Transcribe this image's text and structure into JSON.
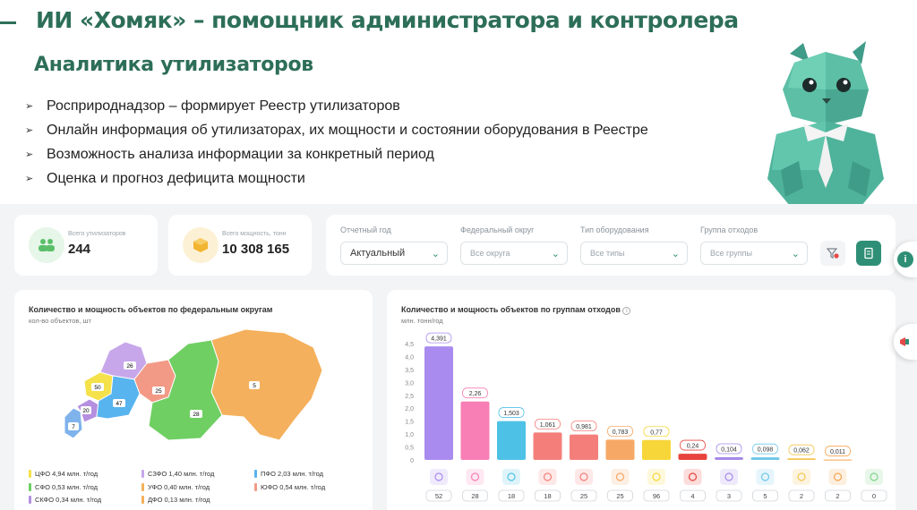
{
  "header": {
    "title": "ИИ «Хомяк» – помощник администратора и контролера",
    "subtitle": "Аналитика утилизаторов",
    "bullets": [
      "Росприроднадзор – формирует Реестр утилизаторов",
      "Онлайн информация об утилизаторах, их мощности и состоянии оборудования в Реестре",
      "Возможность анализа информации за конкретный период",
      "Оценка и прогноз дефицита мощности"
    ]
  },
  "stats": {
    "utilizers": {
      "label": "Всего утилизаторов",
      "value": "244",
      "icon": "people-icon",
      "color": "#5bbf6a"
    },
    "capacity": {
      "label": "Всего мощность, тонн",
      "value": "10 308 165",
      "icon": "cube-icon",
      "color": "#f2b531"
    }
  },
  "filters": [
    {
      "label": "Отчетный год",
      "value": "Актуальный"
    },
    {
      "label": "Федеральный округ",
      "value": "Все округа"
    },
    {
      "label": "Тип оборудования",
      "value": "Все типы"
    },
    {
      "label": "Группа отходов",
      "value": "Все группы"
    }
  ],
  "map_panel": {
    "title": "Количество и мощность объектов по федеральным округам",
    "unit": "кол-во объектов, шт",
    "regions": [
      {
        "label": "7",
        "color": "#7fb3ec"
      },
      {
        "label": "20",
        "color": "#b58fe0"
      },
      {
        "label": "50",
        "color": "#f5e14a"
      },
      {
        "label": "26",
        "color": "#c7a7ea"
      },
      {
        "label": "47",
        "color": "#58b4ee"
      },
      {
        "label": "25",
        "color": "#f29a86"
      },
      {
        "label": "28",
        "color": "#6fcf63"
      },
      {
        "label": "5",
        "color": "#f4b05c"
      }
    ],
    "legend": [
      {
        "text": "ЦФО 4,94 млн. т/год",
        "color": "#f5e14a"
      },
      {
        "text": "СЗФО 1,40 млн. т/год",
        "color": "#c7a7ea"
      },
      {
        "text": "ПФО 2,03 млн. т/год",
        "color": "#58b4ee"
      },
      {
        "text": "СФО 0,53 млн. т/год",
        "color": "#6fcf63"
      },
      {
        "text": "УФО 0,40 млн. т/год",
        "color": "#f4b05c"
      },
      {
        "text": "ЮФО 0,54 млн. т/год",
        "color": "#f29a86"
      },
      {
        "text": "СКФО 0,34 млн. т/год",
        "color": "#b58fe0"
      },
      {
        "text": "ДФО 0,13 млн. т/год",
        "color": "#f4b05c"
      }
    ]
  },
  "chart_data": {
    "type": "bar",
    "title": "Количество и мощность объектов по группам отходов",
    "ylabel": "млн. тонн/год",
    "ylim": [
      0,
      4.5
    ],
    "yticks": [
      "0",
      "0,5",
      "1,0",
      "1,5",
      "2,0",
      "2,5",
      "3,0",
      "3,5",
      "4,0",
      "4,5"
    ],
    "values": [
      4.391,
      2.26,
      1.503,
      1.061,
      0.981,
      0.783,
      0.77,
      0.24,
      0.104,
      0.098,
      0.062,
      0.011,
      0
    ],
    "value_labels": [
      "4,391",
      "2,26",
      "1,503",
      "1,061",
      "0,981",
      "0,783",
      "0,77",
      "0,24",
      "0,104",
      "0,098",
      "0,062",
      "0,011",
      ""
    ],
    "counts": [
      "52",
      "28",
      "18",
      "18",
      "25",
      "25",
      "96",
      "4",
      "3",
      "5",
      "2",
      "2",
      "0"
    ],
    "colors": [
      "#a98bf0",
      "#f77fb6",
      "#4ec2e6",
      "#f47f7a",
      "#f47f7a",
      "#f6a866",
      "#f7d63a",
      "#e8433e",
      "#a58ae8",
      "#6fc7e8",
      "#f4c44f",
      "#f6a44e",
      "#7ed38a"
    ],
    "icons": [
      "paper-icon",
      "bottle-icon",
      "recycle-icon",
      "metal-icon",
      "rubber-icon",
      "brick-icon",
      "battery-icon",
      "box-icon",
      "textile-icon",
      "electronics-icon",
      "lamp-icon",
      "oil-icon",
      "plant-icon"
    ],
    "grid": false
  }
}
